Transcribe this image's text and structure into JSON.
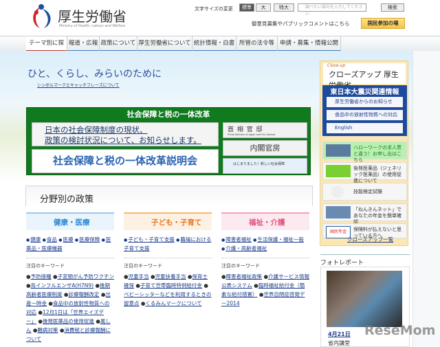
{
  "header": {
    "logo_title": "厚生労働省",
    "logo_sub": "Ministry of Health, Labour and Welfare",
    "font_size_label": "文字サイズの変更",
    "font_sizes": [
      "標準",
      "大",
      "特大"
    ],
    "search_placeholder": "調べたい語句を入力してください",
    "search_button": "検索",
    "public_comment": "御意見募集やパブリックコメントはこちら",
    "participate_button": "国民参加の場"
  },
  "nav": [
    "テーマ別に探す",
    "報道・広報",
    "政策について",
    "厚生労働省について",
    "統計情報・白書",
    "所管の法令等",
    "申請・募集・情報公開"
  ],
  "hero": {
    "tagline": "ひと、くらし、みらいのために",
    "symbol_link": "シンボルマークとキャッチフレーズについて"
  },
  "reform": {
    "title": "社会保障と税の一体改革",
    "box1_line1": "日本の社会保障制度の現状、",
    "box1_line2": "政策の検討状況について、お知らせします。",
    "box2": "社会保障と税の一体改革説明会",
    "kantei": "首 相 官 邸",
    "kantei_sub": "Prime Minister of Japan and His Cabinet",
    "cabinet": "内閣官房",
    "new_ss": "はじまりました！新しい社会保障"
  },
  "closeup": {
    "small": "Close-up",
    "title": "クローズアップ 厚生労働省",
    "quake_title": "東日本大震災関連情報",
    "quake_links": [
      "厚生労働省からのお知らせ",
      "食品中の放射性物質への対応",
      "English"
    ],
    "banners": [
      "ハローワークの求人票と違う！お申し出はこちら",
      "後発医薬品（ジェネリック医薬品）の使用促進について",
      "技能検定試験",
      "「ねんきんネット」であなたの年金を簡単確認",
      "保険料が払えないと思っている方へ"
    ],
    "pension_logo": "国民年金",
    "more": "クローズアップ一覧"
  },
  "policy": {
    "title": "分野別の政策",
    "keyword_label": "注目のキーワード",
    "columns": [
      {
        "title": "健康・医療",
        "links": [
          "健康",
          "食品",
          "医療",
          "医療保険",
          "医薬品・医療機器"
        ],
        "keywords": [
          "予防接種",
          "子宮頸がん予防ワクチン",
          "鳥インフルエンザA(H7N9)",
          "後期高齢者医療制度",
          "診療報酬改定",
          "出産一時金",
          "食品中の放射性物質への対応",
          "12月1日は「世界エイズデー」",
          "後発医薬品の使用促進",
          "風しん",
          "難病対策",
          "消費税と診療報酬について"
        ]
      },
      {
        "title": "子ども・子育て",
        "links": [
          "子ども・子育て支援",
          "職場における子育て支援"
        ],
        "keywords": [
          "児童手当",
          "児童扶養手当",
          "保育士確保",
          "子育て世帯臨時特例給付金",
          "ベビーシッターなどを利用するときの留意点",
          "くるみんマークについて"
        ]
      },
      {
        "title": "福祉・介護",
        "links": [
          "障害者福祉",
          "生活保護・福祉一般",
          "介護・高齢者福祉"
        ],
        "keywords": [
          "障害者福祉政策",
          "介護サービス情報公表システム",
          "臨時福祉給付金（簡素な給付措置）",
          "世界自閉症啓発デー2014"
        ]
      }
    ]
  },
  "photo": {
    "heading": "フォトレポート",
    "date": "4月21日",
    "place": "省内講堂"
  },
  "watermark": "ReseMom",
  "colors": {
    "green": "#0f7a1e",
    "navy": "#1d4a9c",
    "link": "#1a3c8c",
    "health": "#2a8ad8",
    "child": "#e8781e",
    "welfare": "#e0507a"
  }
}
